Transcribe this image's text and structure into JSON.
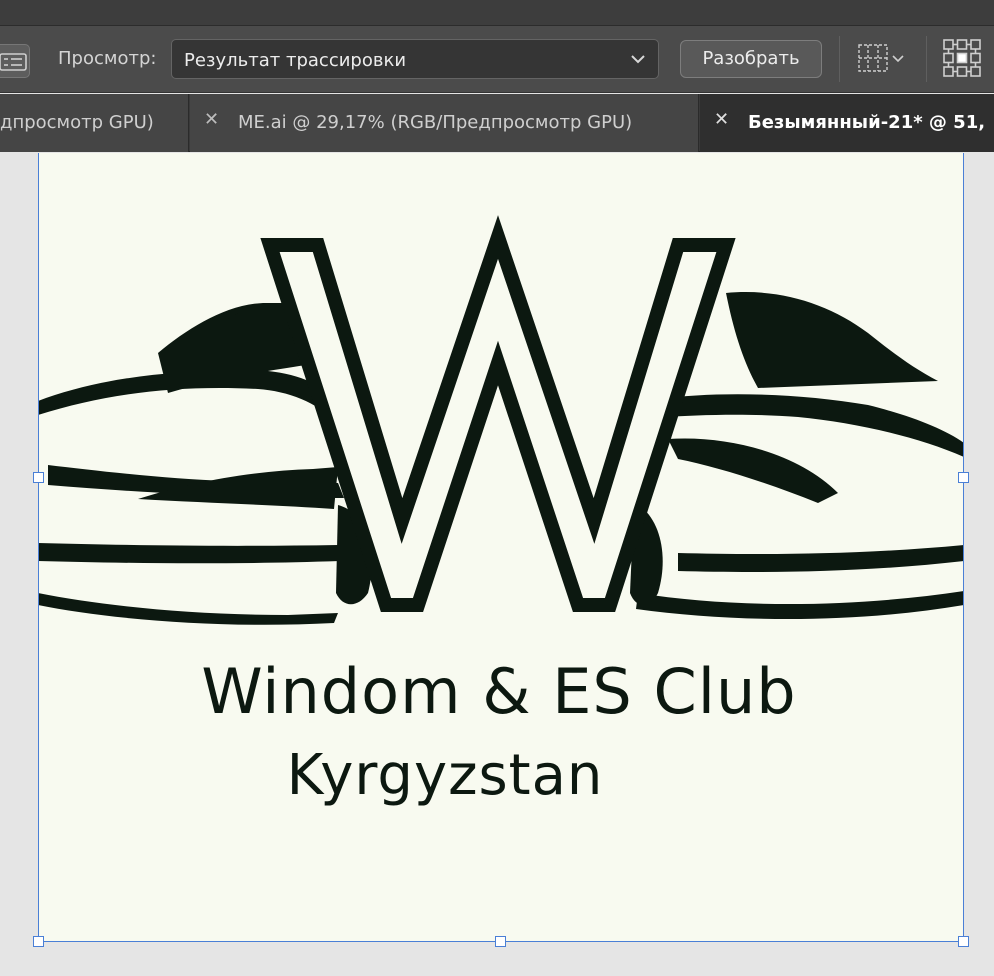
{
  "controlbar": {
    "view_label": "Просмотр:",
    "view_value": "Результат трассировки",
    "expand_button": "Разобрать"
  },
  "tabs": [
    {
      "label": "дпросмотр GPU)",
      "closable": false
    },
    {
      "label": "ME.ai @ 29,17% (RGB/Предпросмотр GPU)",
      "closable": true
    },
    {
      "label": "Безымянный-21* @ 51,",
      "closable": true,
      "active": true
    }
  ],
  "artwork": {
    "line1": "Windom & ES Club",
    "line2": "Kyrgyzstan"
  },
  "colors": {
    "logo_ink": "#0c1810",
    "artboard": "#f8faf0",
    "selection": "#4a7fd6"
  },
  "icons": {
    "panel_toggle": "list-panel-icon",
    "dropdown": "chevron-down-icon",
    "align_grid": "grid-options-icon",
    "reference_point": "reference-point-icon",
    "tab_close": "close-icon"
  }
}
